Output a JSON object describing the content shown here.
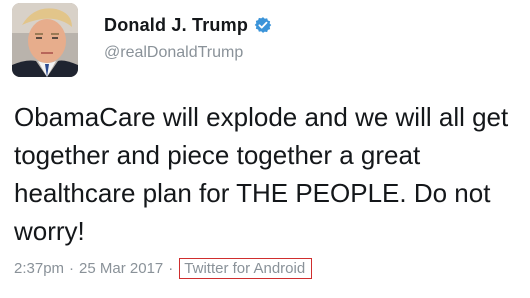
{
  "user": {
    "display_name": "Donald J. Trump",
    "handle": "@realDonaldTrump",
    "verified": true
  },
  "tweet": {
    "text": "ObamaCare will explode and we will all get together and piece together a great healthcare plan for THE PEOPLE. Do not worry!",
    "time": "2:37pm",
    "separator_1": "·",
    "date": "25 Mar 2017",
    "separator_2": "·",
    "source": "Twitter for Android"
  },
  "colors": {
    "verified_badge": "#3b94d9",
    "source_highlight_border": "#cf2e2e",
    "meta_text": "#8a9299"
  }
}
